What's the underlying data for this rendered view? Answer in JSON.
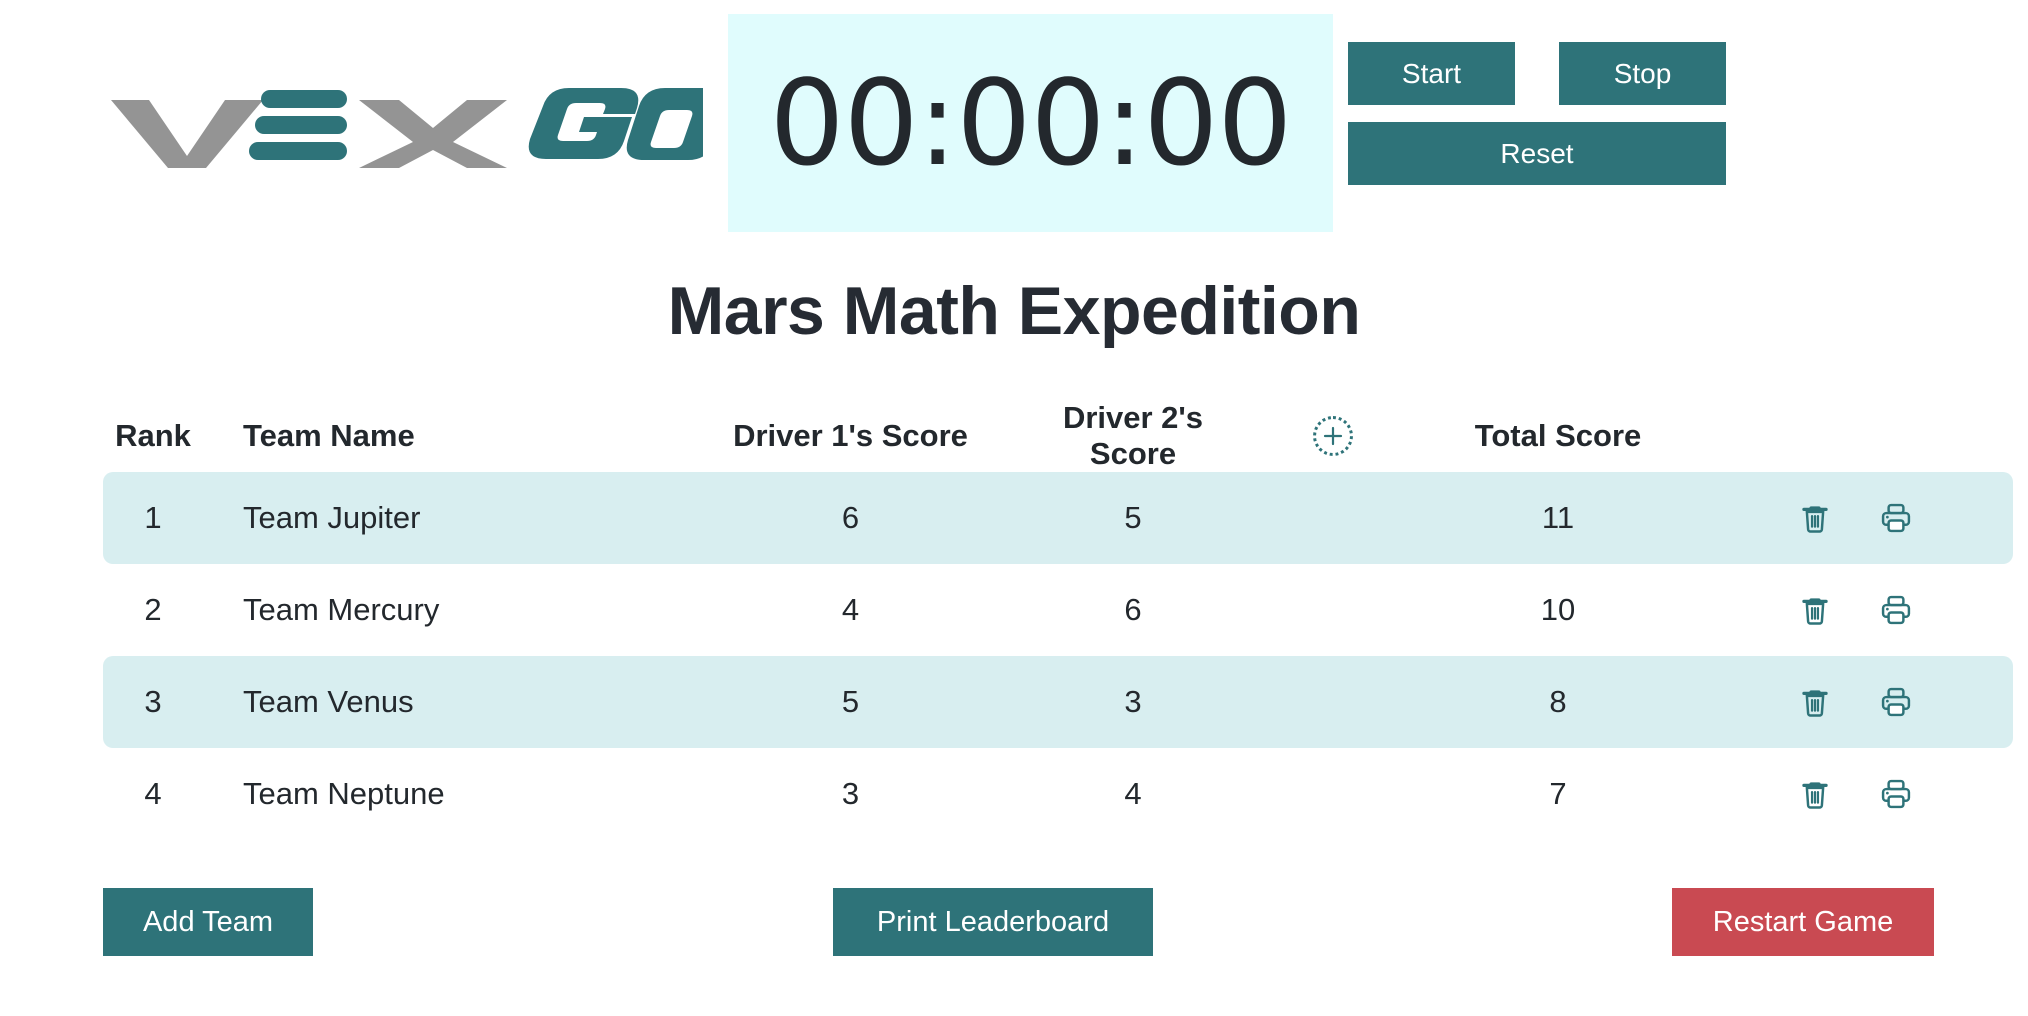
{
  "header": {
    "logo": {
      "vex_text": "VEX",
      "go_text": "GO",
      "alt": "VEX GO logo"
    },
    "timer": {
      "value": "00:00:00"
    },
    "controls": {
      "start_label": "Start",
      "stop_label": "Stop",
      "reset_label": "Reset"
    }
  },
  "title": "Mars Math Expedition",
  "leaderboard": {
    "columns": {
      "rank": "Rank",
      "team_name": "Team Name",
      "driver1": "Driver 1's Score",
      "driver2": "Driver 2's Score",
      "add_column_icon": "plus-circle-icon",
      "add_column_glyph": "+",
      "total": "Total Score"
    },
    "rows": [
      {
        "rank": "1",
        "team": "Team Jupiter",
        "driver1": "6",
        "driver2": "5",
        "total": "11"
      },
      {
        "rank": "2",
        "team": "Team Mercury",
        "driver1": "4",
        "driver2": "6",
        "total": "10"
      },
      {
        "rank": "3",
        "team": "Team Venus",
        "driver1": "5",
        "driver2": "3",
        "total": "8"
      },
      {
        "rank": "4",
        "team": "Team Neptune",
        "driver1": "3",
        "driver2": "4",
        "total": "7"
      }
    ],
    "row_actions": {
      "delete_icon": "trash-icon",
      "print_icon": "printer-icon"
    }
  },
  "footer": {
    "add_team_label": "Add Team",
    "print_leaderboard_label": "Print Leaderboard",
    "restart_game_label": "Restart Game"
  },
  "colors": {
    "teal": "#2e7379",
    "teal_row": "#d8eef0",
    "timer_bg": "#e0fcfd",
    "red": "#c94a52",
    "text_dark": "#23282d",
    "logo_gray": "#949494"
  }
}
